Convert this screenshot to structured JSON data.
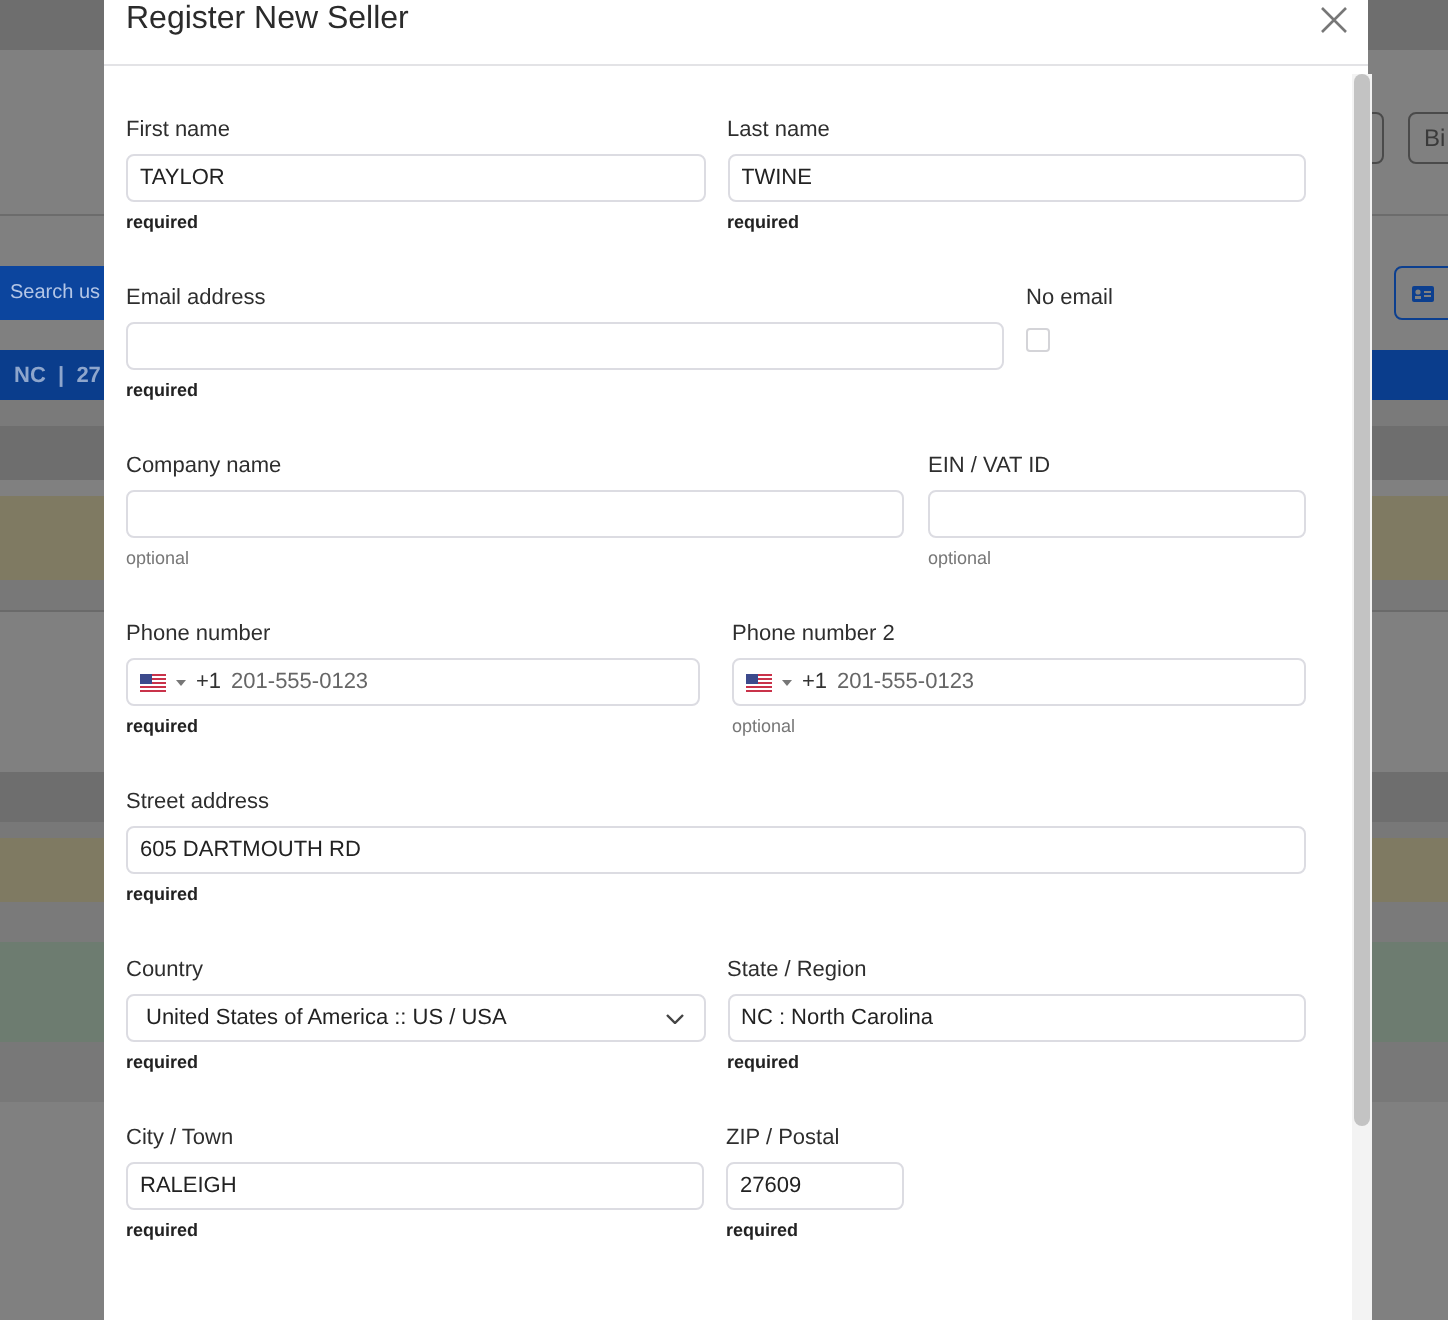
{
  "background": {
    "toolbar_button_label": "Bi",
    "search_placeholder": "Search us",
    "info_bar": "NC  |  27"
  },
  "dialog": {
    "title": "Register New Seller",
    "rows": [
      {
        "fields": [
          {
            "kind": "text",
            "label": "First name",
            "value": "TAYLOR",
            "note": "required",
            "required": true
          },
          {
            "kind": "text",
            "label": "Last name",
            "value": "TWINE",
            "note": "required",
            "required": true
          }
        ]
      },
      {
        "fields": [
          {
            "kind": "text",
            "label": "Email address",
            "note": "required",
            "required": true
          },
          {
            "kind": "checkbox",
            "label": "No email",
            "checked": false
          }
        ]
      },
      {
        "fields": [
          {
            "kind": "text",
            "label": "Company name",
            "note": "optional",
            "required": false
          },
          {
            "kind": "text",
            "label": "EIN / VAT ID",
            "note": "optional",
            "required": false
          }
        ]
      },
      {
        "fields": [
          {
            "kind": "phone",
            "label": "Phone number",
            "dial_code": "+1",
            "placeholder": "201-555-0123",
            "note": "required",
            "required": true
          },
          {
            "kind": "phone",
            "label": "Phone number 2",
            "dial_code": "+1",
            "placeholder": "201-555-0123",
            "note": "optional",
            "required": false
          }
        ]
      },
      {
        "fields": [
          {
            "kind": "text",
            "label": "Street address",
            "value": "605 DARTMOUTH RD",
            "note": "required",
            "required": true
          }
        ]
      },
      {
        "fields": [
          {
            "kind": "select",
            "label": "Country",
            "value": "United States of America :: US / USA",
            "note": "required",
            "required": true
          },
          {
            "kind": "text",
            "label": "State / Region",
            "value": "NC : North Carolina",
            "note": "required",
            "required": true
          }
        ]
      },
      {
        "fields": [
          {
            "kind": "text",
            "label": "City / Town",
            "value": "RALEIGH",
            "note": "required",
            "required": true
          },
          {
            "kind": "text",
            "label": "ZIP / Postal",
            "value": "27609",
            "note": "required",
            "required": true
          }
        ]
      }
    ]
  }
}
